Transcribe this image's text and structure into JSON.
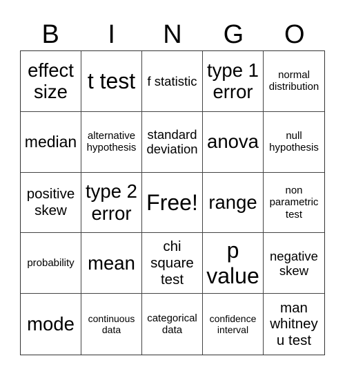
{
  "header": {
    "letters": [
      "B",
      "I",
      "N",
      "G",
      "O"
    ]
  },
  "cells": [
    {
      "text": "effect size",
      "size": "xl"
    },
    {
      "text": "t test",
      "size": "xxl"
    },
    {
      "text": "f statistic",
      "size": "m"
    },
    {
      "text": "type 1 error",
      "size": "xl"
    },
    {
      "text": "normal distribution",
      "size": "s"
    },
    {
      "text": "median",
      "size": "l"
    },
    {
      "text": "alternative hypothesis",
      "size": "s"
    },
    {
      "text": "standard deviation",
      "size": "m"
    },
    {
      "text": "anova",
      "size": "xl"
    },
    {
      "text": "null hypothesis",
      "size": "s"
    },
    {
      "text": "positive skew",
      "size": "ml"
    },
    {
      "text": "type 2 error",
      "size": "xl"
    },
    {
      "text": "Free!",
      "size": "xxl"
    },
    {
      "text": "range",
      "size": "xl"
    },
    {
      "text": "non parametric test",
      "size": "s"
    },
    {
      "text": "probability",
      "size": "s"
    },
    {
      "text": "mean",
      "size": "xl"
    },
    {
      "text": "chi square test",
      "size": "ml"
    },
    {
      "text": "p value",
      "size": "xxl"
    },
    {
      "text": "negative skew",
      "size": "m"
    },
    {
      "text": "mode",
      "size": "xl"
    },
    {
      "text": "continuous data",
      "size": "xs"
    },
    {
      "text": "categorical data",
      "size": "s"
    },
    {
      "text": "confidence interval",
      "size": "xs"
    },
    {
      "text": "man whitney u test",
      "size": "ml"
    }
  ]
}
